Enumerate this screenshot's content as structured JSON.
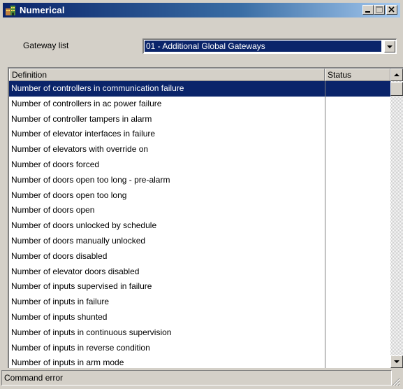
{
  "window": {
    "title": "Numerical"
  },
  "gateway": {
    "label": "Gateway list",
    "selected": "01 - Additional Global Gateways"
  },
  "table": {
    "columns": [
      "Definition",
      "Status"
    ],
    "rows": [
      "Number of controllers in communication failure",
      "Number of controllers in ac power failure",
      "Number of controller tampers in alarm",
      "Number of elevator interfaces in failure",
      "Number of elevators with override on",
      "Number of doors forced",
      "Number of doors open too long - pre-alarm",
      "Number of doors open too long",
      "Number of doors open",
      "Number of doors unlocked by schedule",
      "Number of doors manually unlocked",
      "Number of doors disabled",
      "Number of elevator doors disabled",
      "Number of inputs supervised in failure",
      "Number of inputs in failure",
      "Number of inputs shunted",
      "Number of inputs in continuous supervision",
      "Number of inputs in reverse condition",
      "Number of inputs in arm mode"
    ],
    "selected_index": 0
  },
  "status_bar": {
    "text": "Command error"
  },
  "icons": {
    "app": "building-app-icon",
    "minimize": "minimize-icon",
    "maximize": "maximize-icon",
    "close": "close-icon"
  },
  "colors": {
    "selection": "#0a246a",
    "face": "#d4d0c8"
  }
}
